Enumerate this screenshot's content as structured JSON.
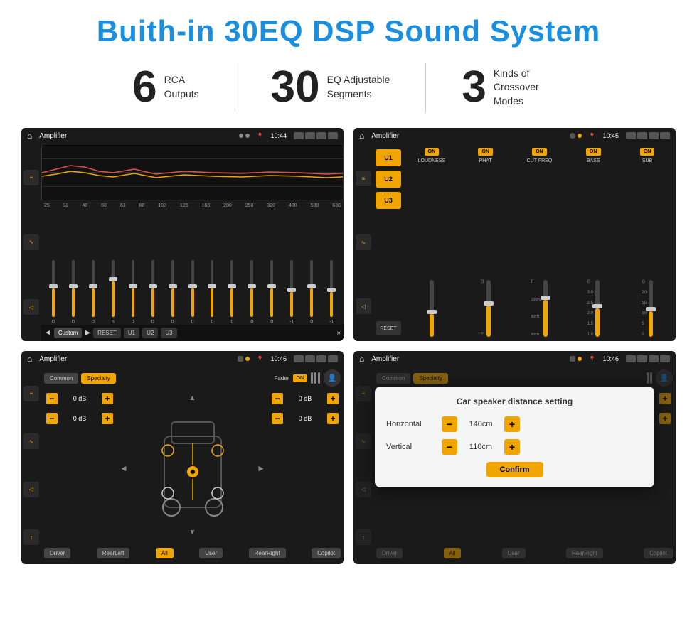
{
  "header": {
    "title": "Buith-in 30EQ DSP Sound System"
  },
  "stats": [
    {
      "number": "6",
      "label_line1": "RCA",
      "label_line2": "Outputs"
    },
    {
      "number": "30",
      "label_line1": "EQ Adjustable",
      "label_line2": "Segments"
    },
    {
      "number": "3",
      "label_line1": "Kinds of",
      "label_line2": "Crossover Modes"
    }
  ],
  "screens": {
    "eq": {
      "title": "Amplifier",
      "time": "10:44",
      "freqs": [
        "25",
        "32",
        "40",
        "50",
        "63",
        "80",
        "100",
        "125",
        "160",
        "200",
        "250",
        "320",
        "400",
        "500",
        "630"
      ],
      "values": [
        "0",
        "0",
        "0",
        "5",
        "0",
        "0",
        "0",
        "0",
        "0",
        "0",
        "0",
        "0",
        "-1",
        "0",
        "-1"
      ],
      "preset": "Custom",
      "buttons": [
        "RESET",
        "U1",
        "U2",
        "U3"
      ]
    },
    "crossover": {
      "title": "Amplifier",
      "time": "10:45",
      "presets": [
        "U1",
        "U2",
        "U3"
      ],
      "channels": [
        "LOUDNESS",
        "PHAT",
        "CUT FREQ",
        "BASS",
        "SUB"
      ],
      "reset_label": "RESET"
    },
    "fader": {
      "title": "Amplifier",
      "time": "10:46",
      "tabs": [
        "Common",
        "Specialty"
      ],
      "fader_label": "Fader",
      "toggle_on": "ON",
      "db_values": [
        "0 dB",
        "0 dB",
        "0 dB",
        "0 dB"
      ],
      "bottom_btns": [
        "Driver",
        "RearLeft",
        "All",
        "User",
        "RearRight",
        "Copilot"
      ]
    },
    "distance": {
      "title": "Amplifier",
      "time": "10:46",
      "dialog_title": "Car speaker distance setting",
      "horizontal_label": "Horizontal",
      "horizontal_value": "140cm",
      "vertical_label": "Vertical",
      "vertical_value": "110cm",
      "confirm_label": "Confirm",
      "bottom_btns": [
        "Driver",
        "RearLeft",
        "All",
        "User",
        "RearRight",
        "Copilot"
      ]
    }
  },
  "icons": {
    "home": "⌂",
    "play": "▶",
    "back_arrow": "◄",
    "forward_arrow": "▶",
    "eq_icon": "≡",
    "wave_icon": "∿",
    "volume_icon": "◁◁",
    "settings_icon": "⚙",
    "plus": "+",
    "minus": "−"
  }
}
